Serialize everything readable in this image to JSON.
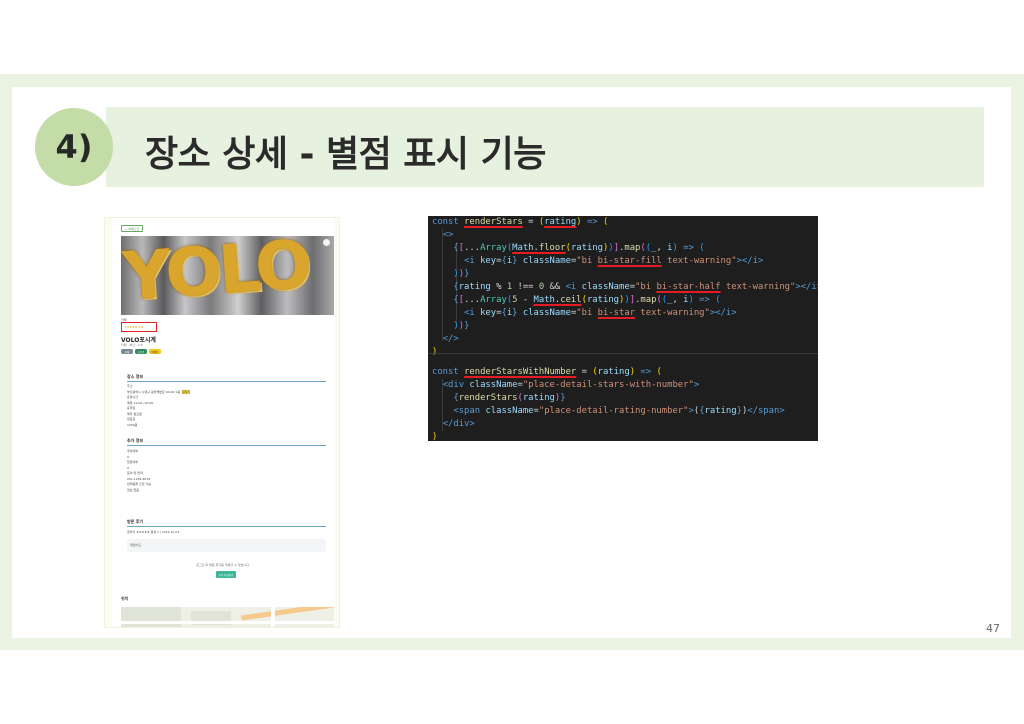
{
  "slide": {
    "number_badge": "4)",
    "title": "장소 상세 - 별점 표시 기능",
    "page_number": "47"
  },
  "screenshot": {
    "back_button": "← 목록으로",
    "hero_text": "YOLO",
    "category_label": "카페",
    "rating_stars": "★★★★★ 4.8",
    "place_name": "VOLO포시계",
    "place_sub": "카페 · 부산 · 4.8",
    "tags": [
      "카페",
      "포토존",
      "이벤트"
    ],
    "info_heading": "장소 정보",
    "info_lines": "주소\n부산광역시 수영구 광안해변로 00-00 1층  ",
    "info_highlight": "길찾기",
    "info_lines2": "운영시간\n매일 11:00~20:00\n휴무일\n매주 월요일\n입장료\n1000원",
    "extra_heading": "추가 정보",
    "extra_lines": "주차여부\nO\n입장여부\nO\n문의 및 연락\n051-1234-5678\n반려동물 출입 가능\n정보 없음",
    "review_heading": "방문 후기",
    "reviewer": "골라치 ★★★★★ 평점 5 | 2024-10-02",
    "review_text": "재밌어요",
    "review_note": "로그인 후 방문 후기를 작성할 수 있습니다.",
    "write_button": "후기 작성하기",
    "location_heading": "위치"
  },
  "code": {
    "block1": [
      "const renderStars = (rating) => (",
      "  <>",
      "    {[...Array(Math.floor(rating))].map((_, i) => (",
      "      <i key={i} className=\"bi bi-star-fill text-warning\"></i>",
      "    ))}",
      "    {rating % 1 !== 0 && <i className=\"bi bi-star-half text-warning\"></i>}",
      "    {[...Array(5 - Math.ceil(rating))].map((_, i) => (",
      "      <i key={i} className=\"bi bi-star text-warning\"></i>",
      "    ))}",
      "  </>",
      ")"
    ],
    "block2": [
      "const renderStarsWithNumber = (rating) => (",
      "  <div className=\"place-detail-stars-with-number\">",
      "    {renderStars(rating)}",
      "    <span className=\"place-detail-rating-number\">({rating})</span>",
      "  </div>",
      ")"
    ]
  },
  "colors": {
    "accent_green": "#c4dca8",
    "title_bar": "#e7f1df",
    "code_bg": "#1e1e1e",
    "underline_red": "#e51c23"
  }
}
